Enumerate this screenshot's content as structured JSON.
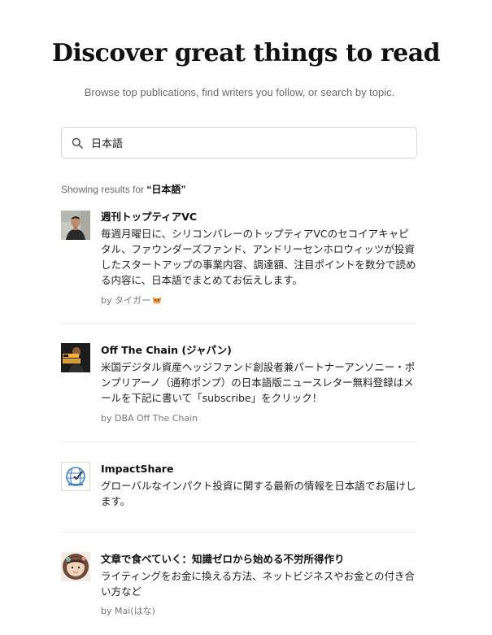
{
  "header": {
    "title": "Discover great things to read",
    "subtitle": "Browse top publications, find writers you follow, or search by topic."
  },
  "search": {
    "value": "日本語",
    "icon": "search-icon"
  },
  "results": {
    "prefix": "Showing results for ",
    "query": "“日本語”"
  },
  "publications": [
    {
      "title": "週刊トップティアVC",
      "description": "毎週月曜日に、シリコンバレーのトップティアVCのセコイアキャピタル、ファウンダーズファンド、アンドリーセンホロウィッツが投資したスタートアップの事業内容、調達額、注目ポイントを数分で読める内容に、日本語でまとめてお伝えします。",
      "by": "by タイガー",
      "avatar": "person-photo"
    },
    {
      "title": "Off The Chain (ジャパン)",
      "description": "米国デジタル資産ヘッジファンド創設者兼パートナーアンソニー・ポンプリアーノ（通称ポンプ）の日本語版ニュースレター無料登録はメールを下記に書いて「subscribe」をクリック！",
      "by": "by DBA Off The Chain",
      "avatar": "off-the-chain-logo"
    },
    {
      "title": "ImpactShare",
      "description": "グローバルなインパクト投資に関する最新の情報を日本語でお届けします。",
      "by": "",
      "avatar": "globe-logo"
    },
    {
      "title": "文章で食べていく：知識ゼロから始める不労所得作り",
      "description": "ライティングをお金に換える方法、ネットビジネスやお金との付き合い方など",
      "by": "by Mai(はな)",
      "avatar": "illustration-avatar"
    }
  ]
}
